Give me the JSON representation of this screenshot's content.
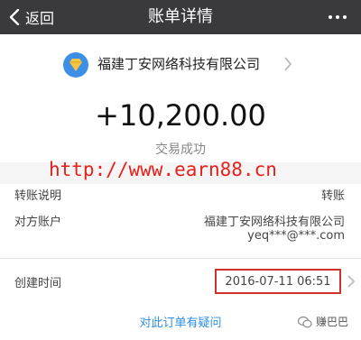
{
  "header": {
    "back_label": "返回",
    "title": "账单详情"
  },
  "merchant": {
    "name": "福建丁安网络科技有限公司"
  },
  "transaction": {
    "amount": "+10,200.00",
    "status": "交易成功"
  },
  "watermark": {
    "url": "http://www.earn88.cn"
  },
  "details": {
    "transfer_desc_label": "转账说明",
    "transfer_desc_value": "转账",
    "counterparty_label": "对方账户",
    "counterparty_name": "福建丁安网络科技有限公司",
    "counterparty_email": "yeq***@***.com"
  },
  "created": {
    "label": "创建时间",
    "value": "2016-07-11 06:51"
  },
  "footer": {
    "question_link": "对此订单有疑问",
    "badge_label": "赚巴巴"
  },
  "colors": {
    "header_bg": "#3a3a3d",
    "accent_link": "#2b8ee3",
    "highlight_border": "#d0312d",
    "watermark": "#e8201c"
  }
}
